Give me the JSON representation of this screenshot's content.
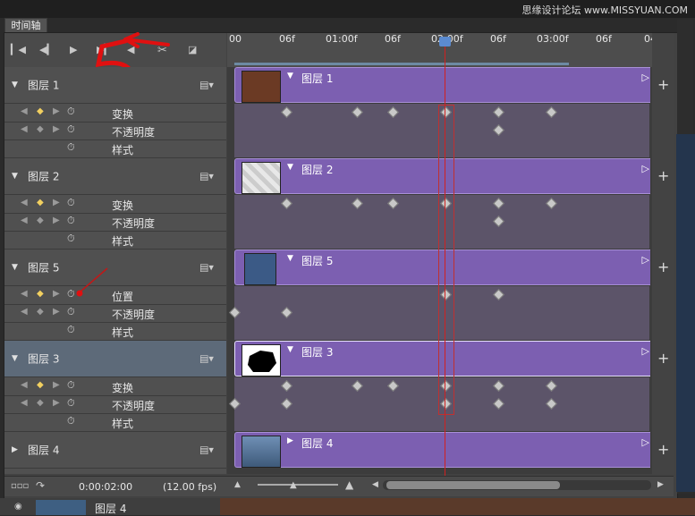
{
  "panel": {
    "tab_title": "时间轴",
    "watermark": "思缘设计论坛 www.MISSYUAN.COM"
  },
  "controls": {
    "icons": [
      "first-frame-icon",
      "prev-frame-icon",
      "play-icon",
      "next-frame-icon",
      "audio-icon",
      "split-icon",
      "transition-icon"
    ]
  },
  "ruler": {
    "labels": [
      "00",
      "06f",
      "01:00f",
      "06f",
      "02:00f",
      "06f",
      "03:00f",
      "06f",
      "04"
    ]
  },
  "layers": [
    {
      "name": "图层 1",
      "expanded": true,
      "props": [
        "变换",
        "不透明度",
        "样式"
      ]
    },
    {
      "name": "图层 2",
      "expanded": true,
      "props": [
        "变换",
        "不透明度",
        "样式"
      ]
    },
    {
      "name": "图层 5",
      "expanded": true,
      "props": [
        "位置",
        "不透明度",
        "样式"
      ]
    },
    {
      "name": "图层 3",
      "expanded": true,
      "selected": true,
      "props": [
        "变换",
        "不透明度",
        "样式"
      ]
    },
    {
      "name": "图层 4",
      "expanded": false,
      "props": []
    }
  ],
  "tracks": [
    {
      "label": "图层 1"
    },
    {
      "label": "图层 2"
    },
    {
      "label": "图层 5"
    },
    {
      "label": "图层 3"
    },
    {
      "label": "图层 4"
    }
  ],
  "footer": {
    "timecode": "0:00:02:00",
    "fps": "(12.00 fps)"
  },
  "under_layer": {
    "name": "图层 4"
  },
  "colors": {
    "clip": "#7c5fb1",
    "playhead": "#d02020",
    "keyframe_active": "#f2d060",
    "selected_row": "#5d6a79"
  }
}
